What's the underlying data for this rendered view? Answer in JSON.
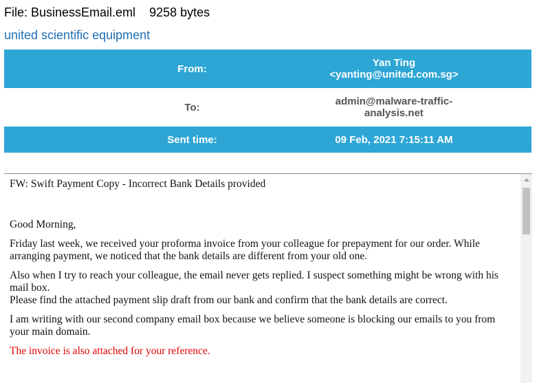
{
  "file": {
    "label": "File: BusinessEmail.eml",
    "size": "9258 bytes"
  },
  "company": "united scientific equipment",
  "header": {
    "from_label": "From:",
    "from_name": "Yan Ting",
    "from_email": "<yanting@united.com.sg>",
    "to_label": "To:",
    "to_line1": "admin@malware-traffic-",
    "to_line2": "analysis.net",
    "sent_label": "Sent time:",
    "sent_value": "09 Feb, 2021 7:15:11 AM"
  },
  "email": {
    "subject": "FW: Swift Payment Copy - Incorrect Bank Details provided",
    "greeting": "Good Morning,",
    "para1": "Friday last week, we received your proforma invoice from your colleague for prepayment for our order. While arranging payment, we noticed that the bank details are different from your old one.",
    "para2_line1": "Also when I try to reach your colleague, the email never gets replied. I suspect something might be wrong with his mail box.",
    "para2_line2": "Please  find the attached  payment  slip draft from our bank and confirm that the bank details are correct.",
    "para3": "I am writing with our second company email box because we believe someone is blocking our emails to you from your main domain.",
    "para4": "The invoice is also attached for your reference."
  },
  "colors": {
    "header_blue": "#2ea6d5",
    "link_blue": "#2a8fc2",
    "company_blue": "#1f6fb4",
    "alert_red": "#e00000"
  },
  "icons": {
    "scroll_up": "chevron-up-icon"
  }
}
